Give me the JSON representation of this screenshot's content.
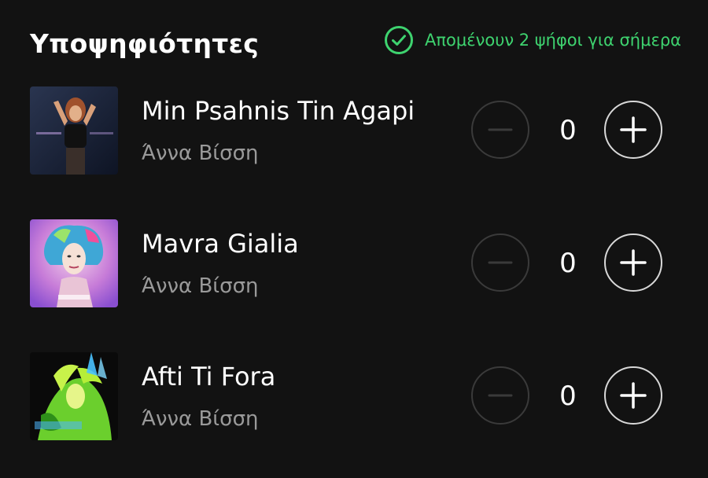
{
  "header": {
    "title": "Υποψηφιότητες",
    "votes_remaining": "Απομένουν 2 ψήφοι για σήμερα"
  },
  "colors": {
    "background": "#121212",
    "accent_green": "#3ed36f",
    "secondary_text": "#9a9a9a"
  },
  "songs": [
    {
      "title": "Min Psahnis Tin Agapi",
      "artist": "Άννα Βίσση",
      "count": "0",
      "cover": "cover-art-1"
    },
    {
      "title": "Mavra Gialia",
      "artist": "Άννα Βίσση",
      "count": "0",
      "cover": "cover-art-2"
    },
    {
      "title": "Afti Ti Fora",
      "artist": "Άννα Βίσση",
      "count": "0",
      "cover": "cover-art-3"
    }
  ],
  "icons": {
    "check": "check-circle-icon",
    "minus": "minus-icon",
    "plus": "plus-icon"
  }
}
